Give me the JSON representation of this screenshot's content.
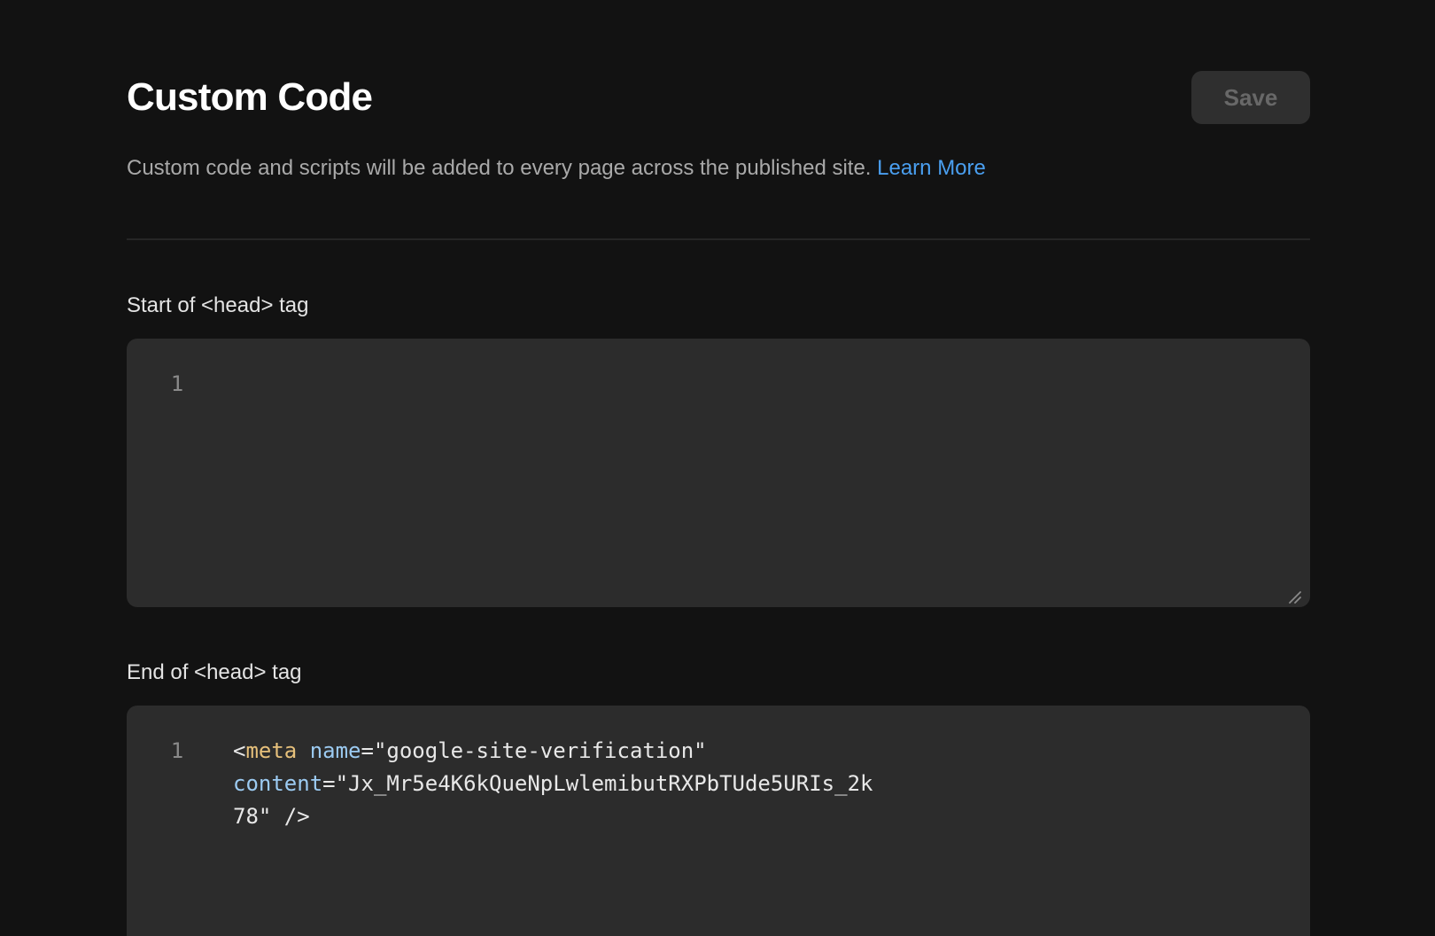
{
  "header": {
    "title": "Custom Code",
    "save_label": "Save"
  },
  "description": {
    "text": "Custom code and scripts will be added to every page across the published site. ",
    "link_label": "Learn More"
  },
  "sections": {
    "head_start": {
      "label": "Start of <head> tag",
      "line_numbers": [
        "1"
      ]
    },
    "head_end": {
      "label": "End of <head> tag",
      "line_numbers": [
        "1"
      ],
      "code": {
        "line1_open": "<",
        "line1_tag": "meta",
        "line1_attr": "name",
        "line1_eq": "=",
        "line1_value": "\"google-site-verification\"",
        "line2_attr": "content",
        "line2_eq": "=",
        "line2_value": "\"Jx_Mr5e4K6kQueNpLwlemibutRXPbTUde5URIs_2k",
        "line3_value": "78\"",
        "line3_close": " />"
      }
    }
  },
  "colors": {
    "background": "#121212",
    "editor_background": "#2c2c2c",
    "accent_link": "#4a9ff0",
    "code_tag": "#e6c07b",
    "code_attr": "#9ccbf2"
  },
  "icons": {
    "resize": "resize-handle-icon"
  }
}
